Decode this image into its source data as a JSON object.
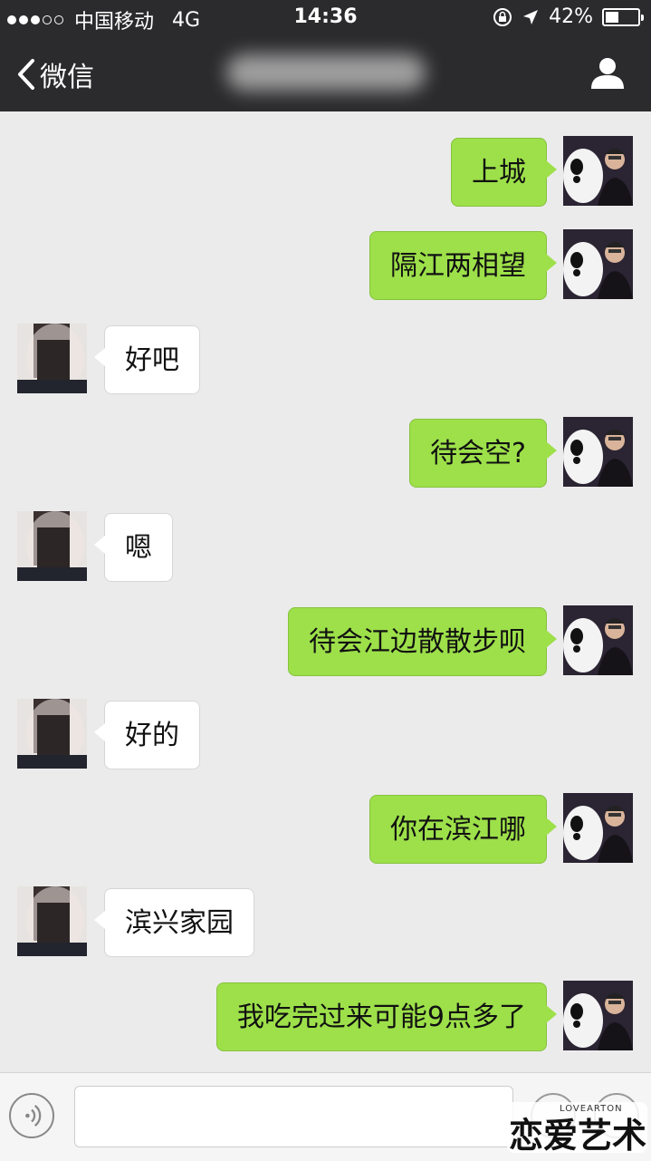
{
  "status_bar": {
    "carrier": "中国移动",
    "network": "4G",
    "time": "14:36",
    "battery": "42%",
    "battery_fraction": 0.42
  },
  "nav": {
    "back_label": "微信",
    "back_icon": "chevron-left-icon",
    "profile_icon": "person-icon"
  },
  "messages": [
    {
      "side": "me",
      "text": "上城"
    },
    {
      "side": "me",
      "text": "隔江两相望"
    },
    {
      "side": "other",
      "text": "好吧"
    },
    {
      "side": "me",
      "text": "待会空?"
    },
    {
      "side": "other",
      "text": "嗯"
    },
    {
      "side": "me",
      "text": "待会江边散散步呗"
    },
    {
      "side": "other",
      "text": "好的"
    },
    {
      "side": "me",
      "text": "你在滨江哪"
    },
    {
      "side": "other",
      "text": "滨兴家园"
    },
    {
      "side": "me",
      "text": "我吃完过来可能9点多了"
    }
  ],
  "input_bar": {
    "voice_icon": "voice-icon",
    "emoji_icon": "emoji-icon",
    "plus_icon": "plus-icon"
  },
  "watermark": {
    "small": "LOVEARTON",
    "large": "恋爱艺术"
  }
}
